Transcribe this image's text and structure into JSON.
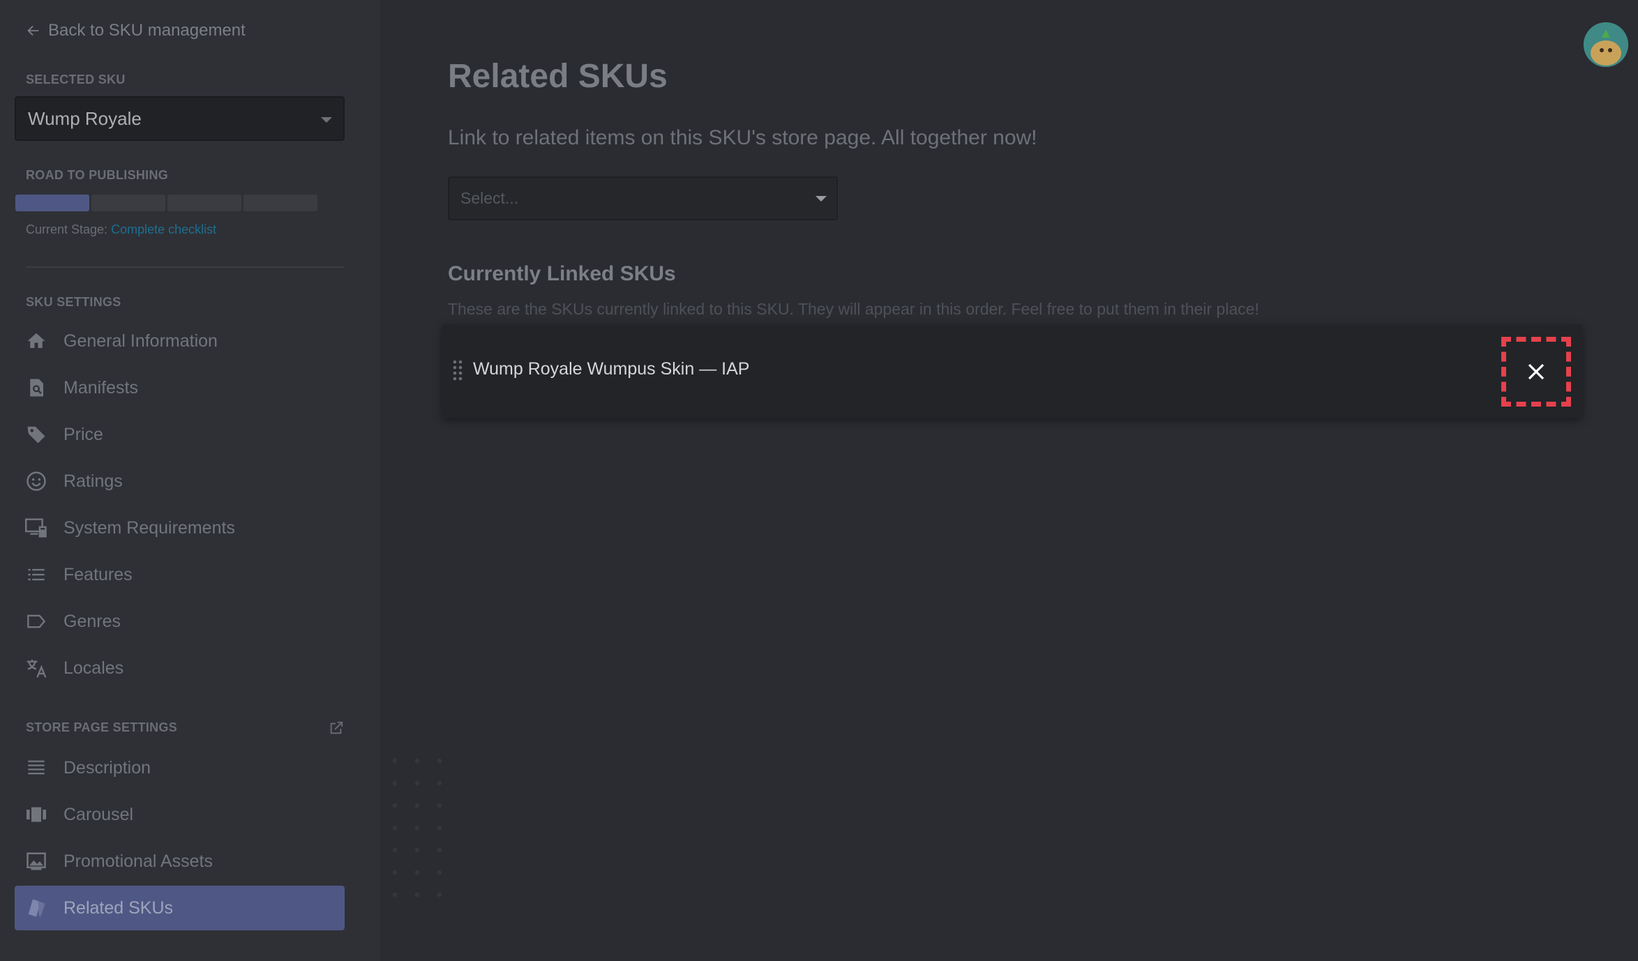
{
  "sidebar": {
    "back_label": "Back to SKU management",
    "selected_sku_label": "SELECTED SKU",
    "selected_sku_value": "Wump Royale",
    "road_label": "ROAD TO PUBLISHING",
    "progress_stage": 1,
    "progress_total": 4,
    "current_stage_label": "Current Stage:",
    "current_stage_value": "Complete checklist",
    "sku_settings_label": "SKU SETTINGS",
    "sku_settings_items": [
      {
        "label": "General Information",
        "icon": "home-icon"
      },
      {
        "label": "Manifests",
        "icon": "manifest-icon"
      },
      {
        "label": "Price",
        "icon": "price-tag-icon"
      },
      {
        "label": "Ratings",
        "icon": "smiley-icon"
      },
      {
        "label": "System Requirements",
        "icon": "computer-icon"
      },
      {
        "label": "Features",
        "icon": "list-icon"
      },
      {
        "label": "Genres",
        "icon": "tag-outline-icon"
      },
      {
        "label": "Locales",
        "icon": "translate-icon"
      }
    ],
    "store_page_label": "STORE PAGE SETTINGS",
    "store_page_items": [
      {
        "label": "Description",
        "icon": "description-icon"
      },
      {
        "label": "Carousel",
        "icon": "carousel-icon"
      },
      {
        "label": "Promotional Assets",
        "icon": "image-icon"
      },
      {
        "label": "Related SKUs",
        "icon": "related-skus-icon",
        "selected": true
      }
    ]
  },
  "main": {
    "title": "Related SKUs",
    "description": "Link to related items on this SKU's store page. All together now!",
    "select_placeholder": "Select...",
    "linked_title": "Currently Linked SKUs",
    "linked_description": "These are the SKUs currently linked to this SKU. They will appear in this order. Feel free to put them in their place!",
    "linked_items": [
      {
        "name": "Wump Royale Wumpus Skin — IAP"
      }
    ]
  },
  "colors": {
    "accent": "#4f5884",
    "link": "#1f6f8f",
    "remove_highlight": "#e6414c"
  }
}
